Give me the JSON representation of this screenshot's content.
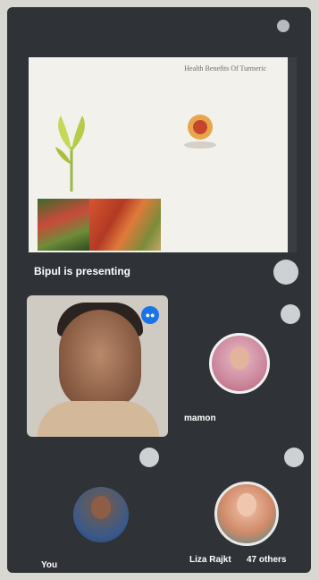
{
  "presentation": {
    "slide_title": "Health Benefits Of Turmeric",
    "slide_subtitle": "",
    "presenter_label": "Bipul is presenting"
  },
  "participants": [
    {
      "name": ""
    },
    {
      "name": "mamon"
    },
    {
      "name": "You"
    },
    {
      "name": "Liza Rajkt"
    }
  ],
  "others_label": "47 others",
  "colors": {
    "background": "#2f3337",
    "slide": "#f2f1ec",
    "accent": "#1a73e8"
  },
  "icons": {
    "more_options": "more-options-icon",
    "mic": "mic-icon"
  }
}
